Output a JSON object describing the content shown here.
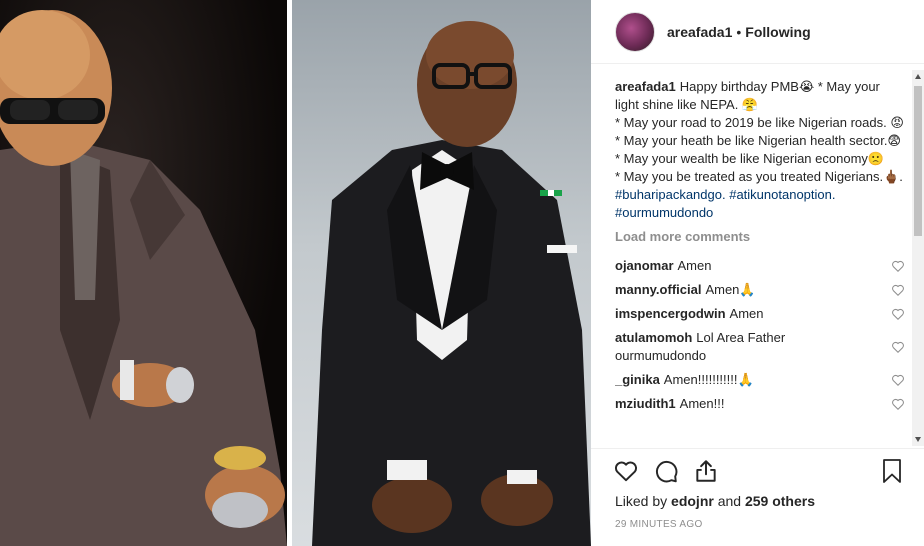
{
  "header": {
    "username": "areafada1",
    "separator": "•",
    "follow_status": "Following"
  },
  "caption": {
    "username": "areafada1",
    "lines": [
      "Happy birthday PMB😭 * May your light shine like NEPA. 😤",
      "* May your road to 2019 be like Nigerian roads. 😡",
      "* May your heath be like Nigerian health sector.😨",
      "* May your wealth be like Nigerian economy🙁",
      "* May you be treated as you treated Nigerians.🖕🏾."
    ],
    "hashtags": [
      "#buharipackandgo.",
      "#atikunotanoption.",
      "#ourmumudondo"
    ]
  },
  "load_more": "Load more comments",
  "comments": [
    {
      "username": "ojanomar",
      "text": "Amen"
    },
    {
      "username": "manny.official",
      "text": "Amen🙏"
    },
    {
      "username": "imspencergodwin",
      "text": "Amen"
    },
    {
      "username": "atulamomoh",
      "text": "Lol Area Father ourmumudondo"
    },
    {
      "username": "_ginika",
      "text": "Amen!!!!!!!!!!!🙏"
    },
    {
      "username": "mziudith1",
      "text": "Amen!!!"
    }
  ],
  "likes": {
    "prefix": "Liked by",
    "user": "edojnr",
    "middle": "and",
    "others": "259 others"
  },
  "timestamp": "29 MINUTES AGO",
  "icons": {
    "like": "heart-icon",
    "comment": "comment-icon",
    "share": "share-icon",
    "save": "bookmark-icon",
    "comment_like": "heart-outline-icon"
  },
  "colors": {
    "text": "#262626",
    "muted": "#8e8e8e",
    "hashtag": "#003569",
    "border": "#efefef"
  }
}
